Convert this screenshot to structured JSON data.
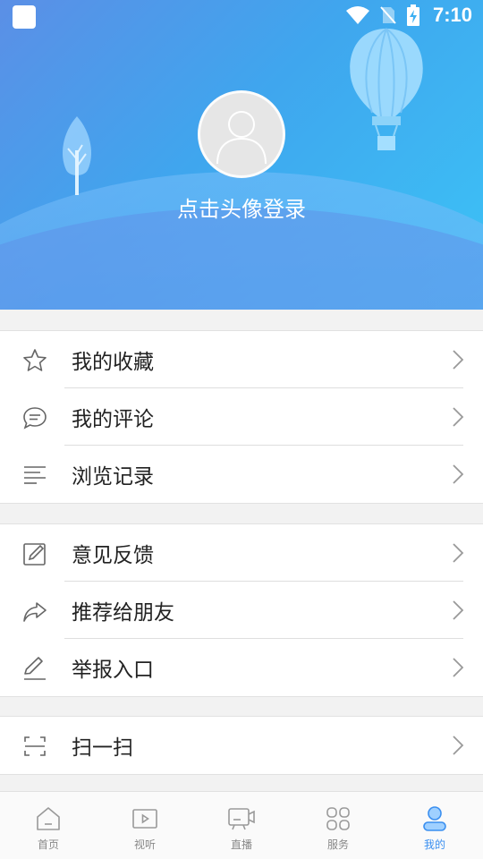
{
  "status_bar": {
    "time": "7:10"
  },
  "header": {
    "login_prompt": "点击头像登录"
  },
  "menu_groups": [
    {
      "items": [
        {
          "label": "我的收藏",
          "icon": "star-icon"
        },
        {
          "label": "我的评论",
          "icon": "comment-icon"
        },
        {
          "label": "浏览记录",
          "icon": "history-list-icon"
        }
      ]
    },
    {
      "items": [
        {
          "label": "意见反馈",
          "icon": "feedback-edit-icon"
        },
        {
          "label": "推荐给朋友",
          "icon": "share-icon"
        },
        {
          "label": "举报入口",
          "icon": "report-pen-icon"
        }
      ]
    },
    {
      "items": [
        {
          "label": "扫一扫",
          "icon": "scan-icon"
        }
      ]
    }
  ],
  "tabbar": {
    "tabs": [
      {
        "label": "首页",
        "icon": "home-icon"
      },
      {
        "label": "视听",
        "icon": "video-play-icon"
      },
      {
        "label": "直播",
        "icon": "live-camera-icon"
      },
      {
        "label": "服务",
        "icon": "services-grid-icon"
      },
      {
        "label": "我的",
        "icon": "profile-icon",
        "active": true
      }
    ]
  },
  "colors": {
    "accent": "#3a8ff0",
    "header_start": "#5b8fe6",
    "header_end": "#3cc3f6"
  }
}
